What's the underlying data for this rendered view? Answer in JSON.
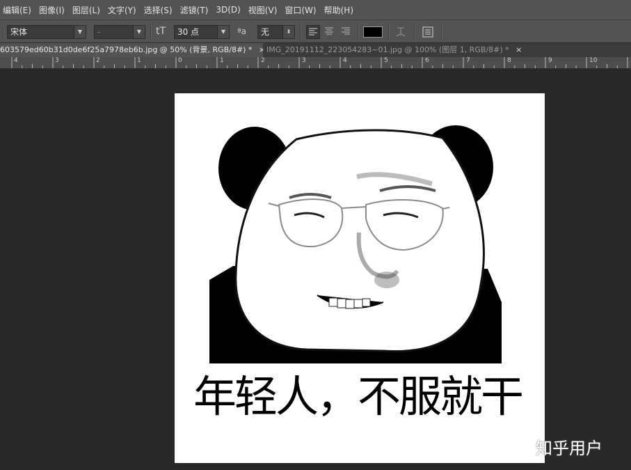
{
  "menubar": {
    "items": [
      "编辑(E)",
      "图像(I)",
      "图层(L)",
      "文字(Y)",
      "选择(S)",
      "滤镜(T)",
      "3D(D)",
      "视图(V)",
      "窗口(W)",
      "帮助(H)"
    ]
  },
  "options": {
    "font_family": "宋体",
    "font_style": "-",
    "font_size": "30 点",
    "anti_alias": "无",
    "text_color": "#000000",
    "size_icon": "tT",
    "aa_icon": "ªa"
  },
  "tabs": [
    {
      "label": "603579ed60b31d0de6f25a7978eb6b.jpg @ 50% (背景, RGB/8#) *",
      "close": "×"
    },
    {
      "label": "IMG_20191112_223054283~01.jpg @ 100% (图层 1, RGB/8#) *",
      "close": "×"
    }
  ],
  "ruler": {
    "labels": [
      "4",
      "3",
      "2",
      "1",
      "0",
      "1",
      "2",
      "3",
      "4",
      "5",
      "6",
      "7",
      "8",
      "9",
      "10"
    ]
  },
  "document": {
    "caption": "年轻人，不服就干"
  },
  "watermark": "知乎用户"
}
